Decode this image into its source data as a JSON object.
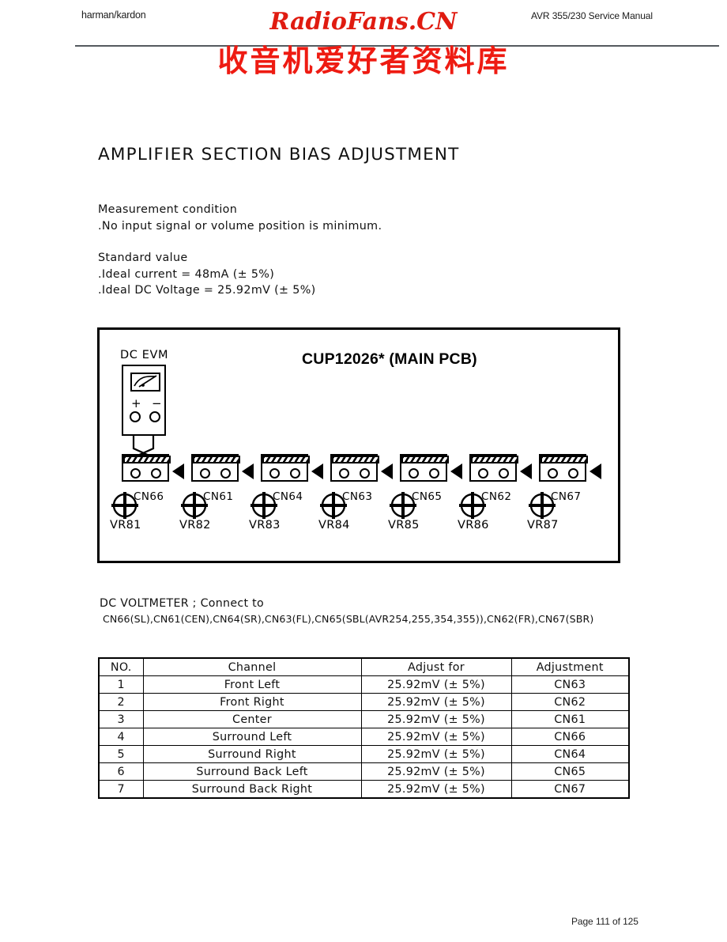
{
  "header": {
    "brand": "harman/kardon",
    "manual": "AVR 355/230 Service Manual",
    "watermark_latin": "RadioFans.CN",
    "watermark_cjk": "收音机爱好者资料库",
    "watermark_color": "#e01b10"
  },
  "document": {
    "title": "AMPLIFIER SECTION BIAS ADJUSTMENT",
    "measurement_condition_heading": "Measurement condition",
    "measurement_condition_line": ".No input signal or volume position is minimum.",
    "standard_value_heading": "Standard value",
    "standard_value_line1": ".Ideal current = 48mA (± 5%)",
    "standard_value_line2": ".Ideal DC Voltage = 25.92mV  (± 5%)"
  },
  "diagram": {
    "pcb_title": "CUP12026* (MAIN PCB)",
    "meter": {
      "label": "DC EVM",
      "plus_terminal": "+",
      "minus_terminal": "−"
    },
    "channels": [
      {
        "connector": "CN66",
        "trimmer": "VR81"
      },
      {
        "connector": "CN61",
        "trimmer": "VR82"
      },
      {
        "connector": "CN64",
        "trimmer": "VR83"
      },
      {
        "connector": "CN63",
        "trimmer": "VR84"
      },
      {
        "connector": "CN65",
        "trimmer": "VR85"
      },
      {
        "connector": "CN62",
        "trimmer": "VR86"
      },
      {
        "connector": "CN67",
        "trimmer": "VR87"
      }
    ]
  },
  "connect_note": {
    "line1": "DC VOLTMETER  ; Connect to",
    "line2": "CN66(SL),CN61(CEN),CN64(SR),CN63(FL),CN65(SBL(AVR254,255,354,355)),CN62(FR),CN67(SBR)"
  },
  "table": {
    "columns": [
      "NO.",
      "Channel",
      "Adjust for",
      "Adjustment"
    ],
    "rows": [
      {
        "no": "1",
        "channel": "Front Left",
        "adjust_for": "25.92mV  (± 5%)",
        "adjustment": "CN63"
      },
      {
        "no": "2",
        "channel": "Front Right",
        "adjust_for": "25.92mV  (± 5%)",
        "adjustment": "CN62"
      },
      {
        "no": "3",
        "channel": "Center",
        "adjust_for": "25.92mV  (± 5%)",
        "adjustment": "CN61"
      },
      {
        "no": "4",
        "channel": "Surround Left",
        "adjust_for": "25.92mV  (± 5%)",
        "adjustment": "CN66"
      },
      {
        "no": "5",
        "channel": "Surround Right",
        "adjust_for": "25.92mV  (± 5%)",
        "adjustment": "CN64"
      },
      {
        "no": "6",
        "channel": "Surround Back Left",
        "adjust_for": "25.92mV  (± 5%)",
        "adjustment": "CN65"
      },
      {
        "no": "7",
        "channel": "Surround Back Right",
        "adjust_for": "25.92mV  (± 5%)",
        "adjustment": "CN67"
      }
    ]
  },
  "footer": {
    "page_label": "Page 111 of 125"
  }
}
